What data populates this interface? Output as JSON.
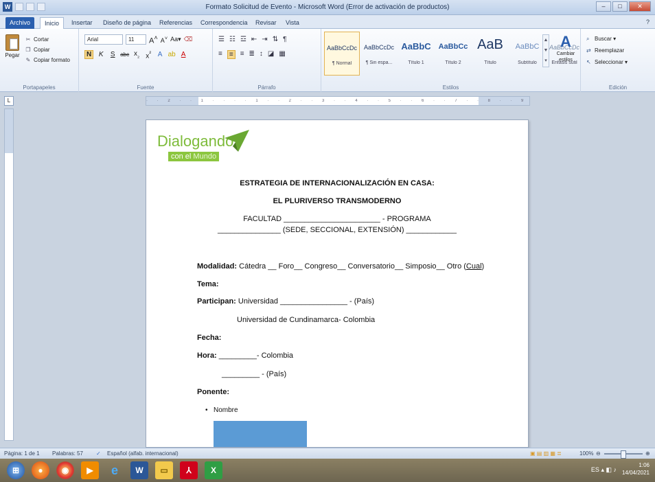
{
  "window": {
    "title": "Formato Solicitud de Evento - Microsoft Word (Error de activación de productos)",
    "app_icon": "W"
  },
  "tabs": [
    "Archivo",
    "Inicio",
    "Insertar",
    "Diseño de página",
    "Referencias",
    "Correspondencia",
    "Revisar",
    "Vista"
  ],
  "ribbon": {
    "clipboard": {
      "paste": "Pegar",
      "cut": "Cortar",
      "copy": "Copiar",
      "format_painter": "Copiar formato",
      "label": "Portapapeles"
    },
    "font": {
      "name": "Arial",
      "size": "11",
      "label": "Fuente"
    },
    "paragraph": {
      "label": "Párrafo"
    },
    "styles": {
      "items": [
        {
          "preview": "AaBbCcDc",
          "label": "¶ Normal"
        },
        {
          "preview": "AaBbCcDc",
          "label": "¶ Sin espa..."
        },
        {
          "preview": "AaBbC",
          "label": "Título 1"
        },
        {
          "preview": "AaBbCc",
          "label": "Título 2"
        },
        {
          "preview": "AaB",
          "label": "Título"
        },
        {
          "preview": "AaBbC",
          "label": "Subtítulo"
        },
        {
          "preview": "AaBbCcDc",
          "label": "Énfasis sutil"
        }
      ],
      "change": "Cambiar estilos",
      "label": "Estilos"
    },
    "editing": {
      "find": "Buscar",
      "replace": "Reemplazar",
      "select": "Seleccionar",
      "label": "Edición"
    }
  },
  "document": {
    "logo_main": "Dialogando",
    "logo_sub_a": "con el",
    "logo_sub_b": "Mundo",
    "title1": "ESTRATEGIA DE INTERNACIONALIZACIÓN EN CASA:",
    "title2": "EL PLURIVERSO TRANSMODERNO",
    "line3": "FACULTAD _______________________ - PROGRAMA",
    "line4": "_______________ (SEDE, SECCIONAL, EXTENSIÓN) ____________",
    "modalidad_label": "Modalidad:",
    "modalidad_value": " Cátedra __ Foro__ Congreso__ Conversatorio__ Simposio__ Otro (",
    "modalidad_cual": "Cual",
    "modalidad_end": ")",
    "tema_label": "Tema:",
    "participan_label": "Participan:",
    "participan_value": " Universidad ________________ - (País)",
    "participan_line2": "Universidad de Cundinamarca- Colombia",
    "fecha_label": "Fecha:",
    "hora_label": "Hora:",
    "hora_value": " _________- Colombia",
    "hora_line2": "_________ - (País)",
    "ponente_label": "Ponente:",
    "bullet1": "Nombre"
  },
  "statusbar": {
    "page": "Página: 1 de 1",
    "words": "Palabras: 57",
    "language": "Español (alfab. internacional)",
    "zoom": "100%"
  },
  "taskbar": {
    "lang": "ES",
    "time": "1:06",
    "date": "14/04/2021"
  },
  "colors": {
    "logo_green": "#7dbb3a",
    "blue_box": "#5b9bd5",
    "ribbon_file_tab": "#2a5fae"
  }
}
